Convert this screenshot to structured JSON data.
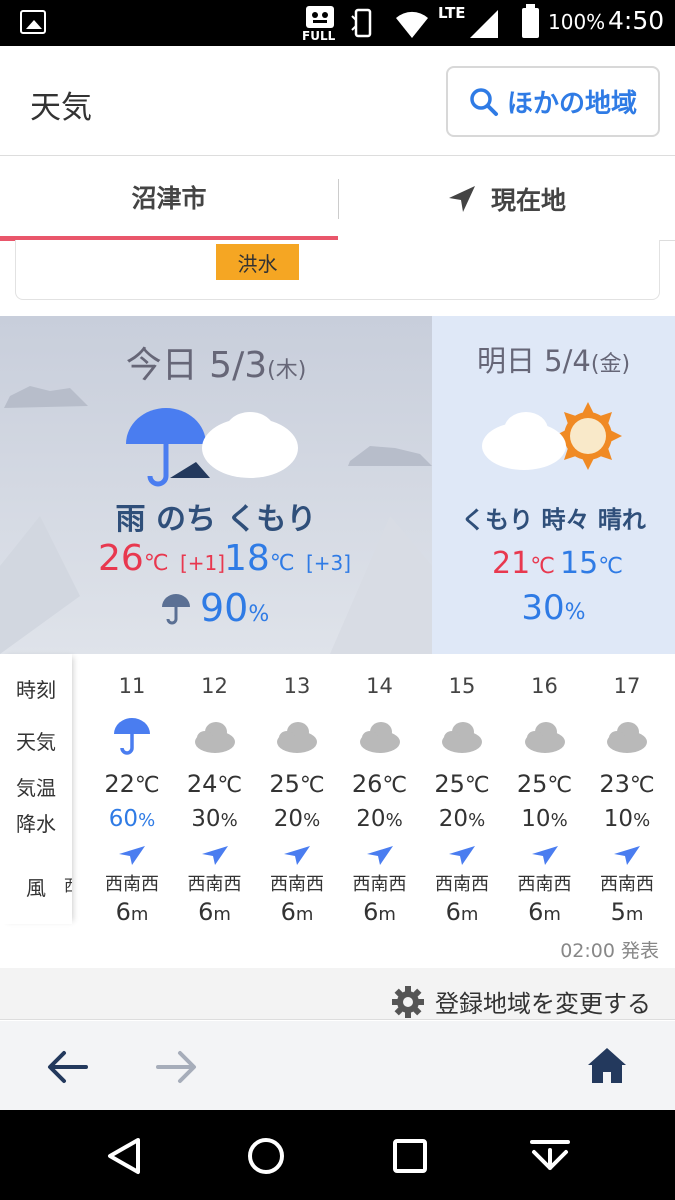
{
  "statusbar": {
    "full_label": "FULL",
    "lte_label": "LTE",
    "battery": "100%",
    "time": "4:50"
  },
  "header": {
    "title": "天気",
    "other_region_button": "ほかの地域"
  },
  "tabs": [
    {
      "label": "沼津市"
    },
    {
      "label": "現在地"
    }
  ],
  "alert": {
    "badge": "洪水"
  },
  "today": {
    "date_label": "今日 5/3",
    "weekday": "(木)",
    "weather": "雨 のち くもり",
    "high": "26",
    "high_diff": "[+1]",
    "low": "18",
    "low_diff": "[+3]",
    "unit": "℃",
    "precip": "90",
    "precip_unit": "%"
  },
  "tomorrow": {
    "date_label": "明日 5/4",
    "weekday": "(金)",
    "weather": "くもり 時々 晴れ",
    "high": "21",
    "low": "15",
    "unit": "℃",
    "precip": "30",
    "precip_unit": "%"
  },
  "hourly": {
    "row_labels": {
      "time": "時刻",
      "weather": "天気",
      "temp": "気温",
      "rain": "降水",
      "wind": "風"
    },
    "partial_cut_wind_dir": "西",
    "temp_unit": "℃",
    "rain_unit": "%",
    "wind_unit": "m",
    "hours": [
      {
        "hour": "11",
        "icon": "umbrella-icon",
        "temp": "22",
        "rain": "60",
        "wind_dir": "西南西",
        "wind_speed": "6"
      },
      {
        "hour": "12",
        "icon": "cloud-icon",
        "temp": "24",
        "rain": "30",
        "wind_dir": "西南西",
        "wind_speed": "6"
      },
      {
        "hour": "13",
        "icon": "cloud-icon",
        "temp": "25",
        "rain": "20",
        "wind_dir": "西南西",
        "wind_speed": "6"
      },
      {
        "hour": "14",
        "icon": "cloud-icon",
        "temp": "26",
        "rain": "20",
        "wind_dir": "西南西",
        "wind_speed": "6"
      },
      {
        "hour": "15",
        "icon": "cloud-icon",
        "temp": "25",
        "rain": "20",
        "wind_dir": "西南西",
        "wind_speed": "6"
      },
      {
        "hour": "16",
        "icon": "cloud-icon",
        "temp": "25",
        "rain": "10",
        "wind_dir": "西南西",
        "wind_speed": "6"
      },
      {
        "hour": "17",
        "icon": "cloud-icon",
        "temp": "23",
        "rain": "10",
        "wind_dir": "西南西",
        "wind_speed": "5"
      }
    ],
    "issued": "02:00 発表"
  },
  "settings": {
    "change_region_label": "登録地域を変更する"
  },
  "colors": {
    "accent_blue": "#2f7be5",
    "high_red": "#e8384f",
    "tab_underline": "#e9566b",
    "alert_orange": "#f5a623",
    "navy": "#2f4f7a"
  }
}
